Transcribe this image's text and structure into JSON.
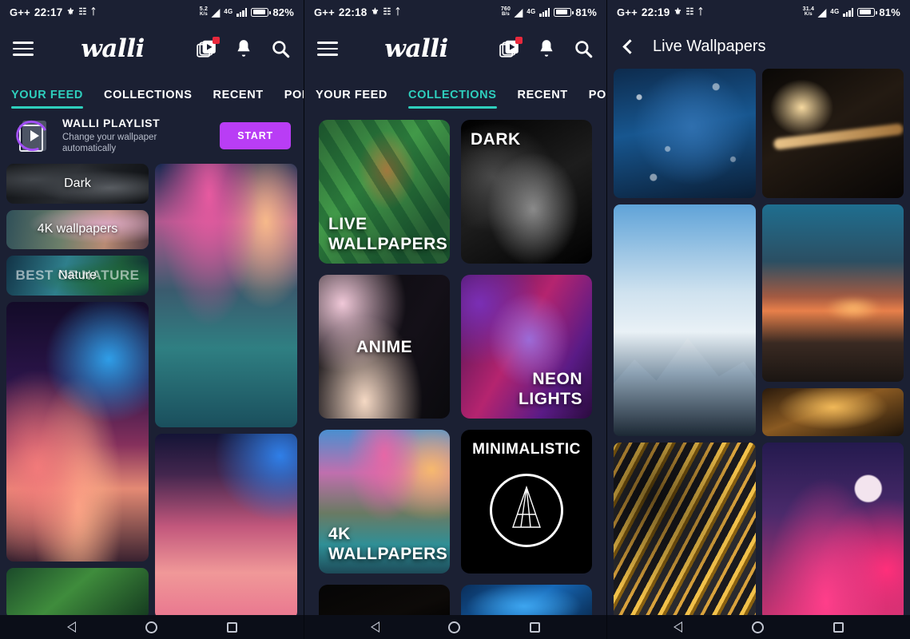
{
  "panels": [
    {
      "status": {
        "carrier": "G++",
        "time": "22:17",
        "icons": [
          "vpn-icon",
          "nfc-icon",
          "bluetooth-icon"
        ],
        "net_speed_value": "5.2",
        "net_speed_unit": "K/s",
        "wifi": "wifi-icon",
        "signal": "4G",
        "battery_percent": "82%"
      },
      "appbar": {
        "menu": "hamburger-icon",
        "logo": "walli",
        "icons": [
          "playlist-icon",
          "bell-icon",
          "search-icon"
        ],
        "badge": true
      },
      "tabs": [
        {
          "label": "YOUR FEED",
          "active": true
        },
        {
          "label": "COLLECTIONS",
          "active": false
        },
        {
          "label": "RECENT",
          "active": false
        },
        {
          "label": "POPUL",
          "active": false
        }
      ],
      "playlist": {
        "title": "WALLI PLAYLIST",
        "subtitle": "Change your wallpaper\nautomatically",
        "button": "START"
      },
      "chips": [
        {
          "label": "Dark",
          "ghost": ""
        },
        {
          "label": "4K wallpapers",
          "ghost": ""
        },
        {
          "label": "Nature",
          "ghost": "BEST OF NATURE"
        }
      ],
      "wallpapers_left": [
        "galaxy-city-sunset",
        "jungle-leaves"
      ],
      "wallpapers_right": [
        "fantasy-mountain-lake",
        "pink-clouds-night"
      ]
    },
    {
      "status": {
        "carrier": "G++",
        "time": "22:18",
        "icons": [
          "vpn-icon",
          "nfc-icon",
          "bluetooth-icon"
        ],
        "net_speed_value": "760",
        "net_speed_unit": "B/s",
        "wifi": "wifi-icon",
        "signal": "4G",
        "battery_percent": "81%"
      },
      "appbar": {
        "menu": "hamburger-icon",
        "logo": "walli",
        "icons": [
          "playlist-icon",
          "bell-icon",
          "search-icon"
        ],
        "badge": true
      },
      "tabs": [
        {
          "label": "YOUR FEED",
          "active": false
        },
        {
          "label": "COLLECTIONS",
          "active": true
        },
        {
          "label": "RECENT",
          "active": false
        },
        {
          "label": "POPUL",
          "active": false
        }
      ],
      "collections": [
        {
          "label": "LIVE\nWALLPAPERS",
          "art": "fox-in-leaves",
          "align": "bottom-left"
        },
        {
          "label": "DARK",
          "art": "dark-smoke",
          "align": "top-left"
        },
        {
          "label": "ANIME",
          "art": "anime-pink-waves",
          "align": "center"
        },
        {
          "label": "NEON\nLIGHTS",
          "art": "neon-portrait",
          "align": "bottom-right"
        },
        {
          "label": "4K\nWALLPAPERS",
          "art": "coastline-sunset",
          "align": "bottom-left"
        },
        {
          "label": "MINIMALISTIC",
          "art": "black-mountain-logo",
          "align": "top-center"
        },
        {
          "label": "",
          "art": "black-partial",
          "align": "none"
        },
        {
          "label": "",
          "art": "blue-partial",
          "align": "none"
        }
      ]
    },
    {
      "status": {
        "carrier": "G++",
        "time": "22:19",
        "icons": [
          "vpn-icon",
          "nfc-icon",
          "bluetooth-icon"
        ],
        "net_speed_value": "31.4",
        "net_speed_unit": "K/s",
        "wifi": "wifi-icon",
        "signal": "4G",
        "battery_percent": "81%"
      },
      "header": {
        "back": "back-chevron-icon",
        "title": "Live Wallpapers"
      },
      "wallpapers_left": [
        "snowy-night-climber",
        "cloudy-mountain-peak",
        "gold-marble-swirl"
      ],
      "wallpapers_right": [
        "light-trail-bridge",
        "sunset-hills",
        "autumn-valley",
        "pink-moon-canyon"
      ]
    }
  ],
  "navbar": {
    "back": "nav-back-icon",
    "home": "nav-home-icon",
    "recents": "nav-recents-icon"
  },
  "colors": {
    "background": "#1b2033",
    "accent_teal": "#2ecfbd",
    "accent_purple": "#b93df5",
    "badge_red": "#e8283c",
    "navbar": "#0b0e18",
    "text": "#ffffff"
  }
}
